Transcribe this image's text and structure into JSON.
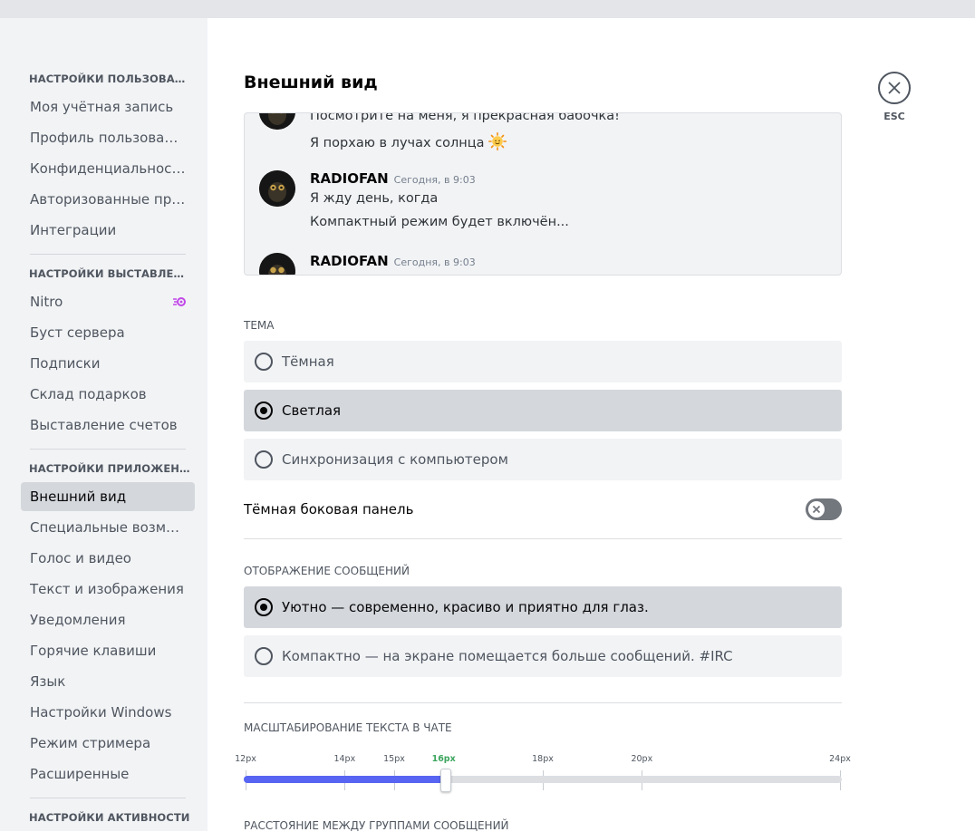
{
  "sidebar": {
    "headers": [
      "Настройки пользователя",
      "Настройки выставлени...",
      "Настройки приложения",
      "Настройки активности"
    ],
    "user_items": [
      "Моя учётная запись",
      "Профиль пользователя",
      "Конфиденциальность",
      "Авторизованные прил...",
      "Интеграции"
    ],
    "billing_items": [
      "Nitro",
      "Буст сервера",
      "Подписки",
      "Склад подарков",
      "Выставление счетов"
    ],
    "app_items": [
      "Внешний вид",
      "Специальные возмож...",
      "Голос и видео",
      "Текст и изображения",
      "Уведомления",
      "Горячие клавиши",
      "Язык",
      "Настройки Windows",
      "Режим стримера",
      "Расширенные"
    ],
    "active": "Внешний вид"
  },
  "page": {
    "title": "Внешний вид",
    "esc": "ESC"
  },
  "preview": {
    "msg0_line1": "Посмотрите на меня, я прекрасная бабочка!",
    "msg0_line2": "Я порхаю в лучах солнца",
    "msg1_author": "RADIOFAN",
    "msg1_time": "Сегодня, в 9:03",
    "msg1_line1": "Я жду день, когда",
    "msg1_line2": "Компактный режим будет включён...",
    "msg2_author": "RADIOFAN",
    "msg2_time": "Сегодня, в 9:03"
  },
  "theme": {
    "label": "Тема",
    "options": [
      "Тёмная",
      "Светлая",
      "Синхронизация с компьютером"
    ],
    "selected": 1
  },
  "dark_sidebar": {
    "label": "Тёмная боковая панель",
    "enabled": false
  },
  "message_display": {
    "label": "Отображение сообщений",
    "options": [
      "Уютно — современно, красиво и приятно для глаз.",
      "Компактно — на экране помещается больше сообщений. #IRC"
    ],
    "selected": 0
  },
  "font_scaling": {
    "label": "Масштабирование текста в чате",
    "ticks": [
      "12px",
      "14px",
      "15px",
      "16px",
      "18px",
      "20px",
      "24px"
    ],
    "tick_values": [
      12,
      14,
      15,
      16,
      18,
      20,
      24
    ],
    "value": 16,
    "min": 12,
    "max": 24
  },
  "group_spacing": {
    "label": "Расстояние между группами сообщений"
  },
  "colors": {
    "accent": "#5865f2",
    "active_tick": "#3ba55d",
    "nitro": "#ff73fa"
  }
}
